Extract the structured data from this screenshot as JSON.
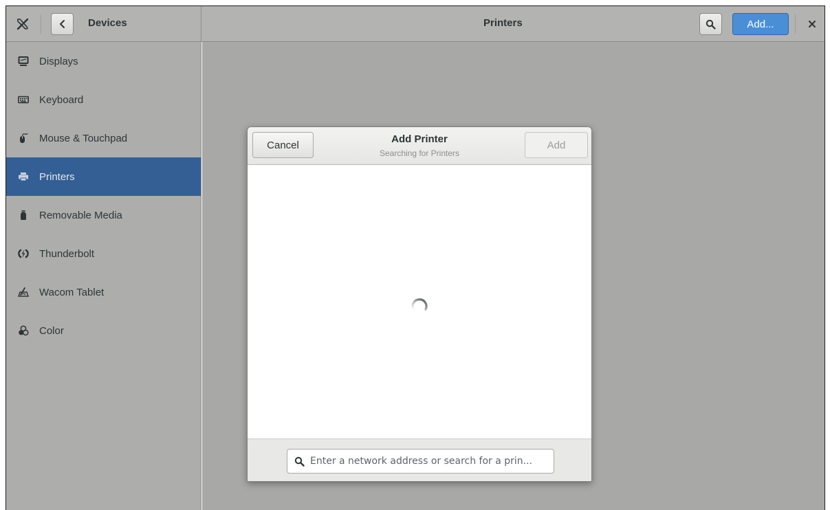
{
  "header": {
    "tools_icon": "tools-icon",
    "back_icon": "chevron-left-icon",
    "section_title": "Devices",
    "page_title": "Printers",
    "search_icon": "search-icon",
    "add_label": "Add...",
    "close_icon": "close-icon"
  },
  "sidebar": {
    "items": [
      {
        "label": "Displays",
        "icon": "display-icon"
      },
      {
        "label": "Keyboard",
        "icon": "keyboard-icon"
      },
      {
        "label": "Mouse & Touchpad",
        "icon": "mouse-icon"
      },
      {
        "label": "Printers",
        "icon": "printer-icon"
      },
      {
        "label": "Removable Media",
        "icon": "usb-drive-icon"
      },
      {
        "label": "Thunderbolt",
        "icon": "thunderbolt-icon"
      },
      {
        "label": "Wacom Tablet",
        "icon": "tablet-icon"
      },
      {
        "label": "Color",
        "icon": "color-icon"
      }
    ],
    "active_index": 3
  },
  "dialog": {
    "cancel_label": "Cancel",
    "title": "Add Printer",
    "subtitle": "Searching for Printers",
    "add_label": "Add",
    "search_placeholder": "Enter a network address or search for a prin...",
    "search_value": ""
  },
  "colors": {
    "accent": "#4a8fd6",
    "sidebar_selected": "#335f95",
    "sidebar_bg": "#adadac",
    "header_bg": "#b3b3b2"
  }
}
